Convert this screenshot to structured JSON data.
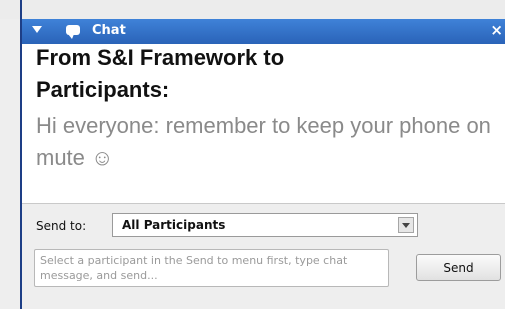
{
  "titlebar": {
    "title": "Chat",
    "close_glyph": "×",
    "collapse_icon": "collapse-triangle-icon",
    "chat_icon": "chat-bubble-icon",
    "color": "#2f6fc7"
  },
  "messages": [
    {
      "sender": "From S&I Framework to Participants:",
      "text": "Hi everyone: remember to keep your phone on mute ☺"
    }
  ],
  "compose": {
    "send_to_label": "Send to:",
    "recipient": "All Participants",
    "dropdown_icon": "chevron-down-icon",
    "input_placeholder": "Select a participant in the Send to menu first, type chat message, and send...",
    "send_label": "Send"
  }
}
